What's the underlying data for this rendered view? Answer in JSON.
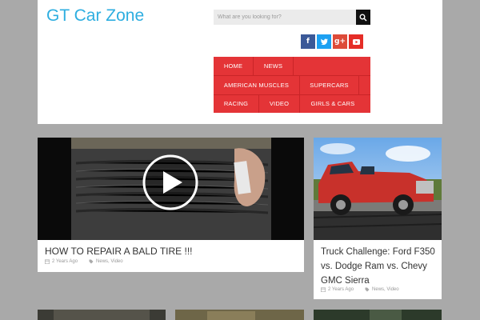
{
  "site": {
    "title": "GT Car Zone"
  },
  "search": {
    "placeholder": "What are you looking for?",
    "icon": "search-icon"
  },
  "social": [
    {
      "name": "facebook",
      "glyph": "f",
      "color": "#3b5998"
    },
    {
      "name": "twitter",
      "glyph": "t",
      "color": "#1da1f2"
    },
    {
      "name": "google-plus",
      "glyph": "g+",
      "color": "#dd4b39"
    },
    {
      "name": "youtube",
      "glyph": "▶",
      "color": "#e52d27"
    }
  ],
  "nav": {
    "color": "#e43437",
    "row1": [
      "HOME",
      "NEWS"
    ],
    "row2": [
      "AMERICAN MUSCLES",
      "SUPERCARS"
    ],
    "row3": [
      "RACING",
      "VIDEO",
      "GIRLS & CARS"
    ]
  },
  "posts": [
    {
      "title": "HOW TO REPAIR A BALD TIRE !!!",
      "date": "2 Years Ago",
      "categories": "News, Video"
    },
    {
      "title": "Truck Challenge: Ford F350 vs. Dodge Ram vs. Chevy GMC Sierra",
      "date": "2 Years Ago",
      "categories": "News, Video"
    }
  ],
  "colors": {
    "title": "#2eaee0",
    "background": "#a9a9a9"
  }
}
